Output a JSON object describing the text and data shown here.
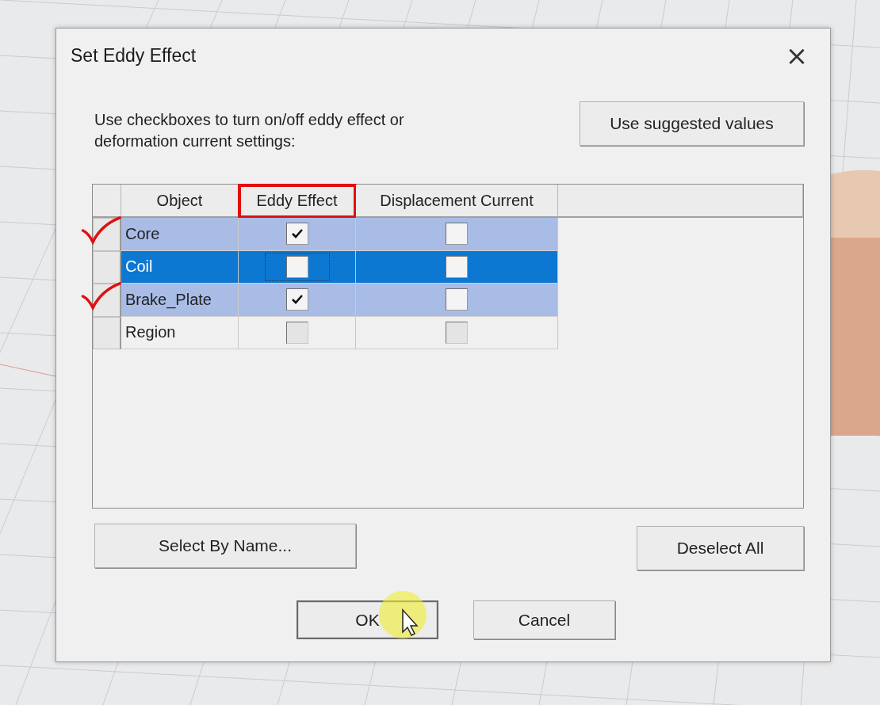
{
  "dialog": {
    "title": "Set Eddy Effect",
    "close": "×"
  },
  "instructions": "Use checkboxes to turn on/off eddy effect or deformation current settings:",
  "suggest_button": "Use suggested values",
  "table": {
    "columns": [
      {
        "label": "Object",
        "annotated": false
      },
      {
        "label": "Eddy Effect",
        "annotated": true
      },
      {
        "label": "Displacement Current",
        "annotated": false
      }
    ],
    "rows": [
      {
        "object": "Core",
        "selected": true,
        "focused": false,
        "disabled": false,
        "annotated": true,
        "eddy": true,
        "displacement": false
      },
      {
        "object": "Coil",
        "selected": true,
        "focused": true,
        "disabled": false,
        "annotated": false,
        "eddy": false,
        "displacement": false
      },
      {
        "object": "Brake_Plate",
        "selected": true,
        "focused": false,
        "disabled": false,
        "annotated": true,
        "eddy": true,
        "displacement": false
      },
      {
        "object": "Region",
        "selected": false,
        "focused": false,
        "disabled": true,
        "annotated": false,
        "eddy": false,
        "displacement": false
      }
    ]
  },
  "select_by_name_button": "Select By Name...",
  "deselect_all_button": "Deselect All",
  "buttons": [
    {
      "label": "OK",
      "default": true,
      "cursor": true
    },
    {
      "label": "Cancel",
      "default": false,
      "cursor": false
    }
  ]
}
